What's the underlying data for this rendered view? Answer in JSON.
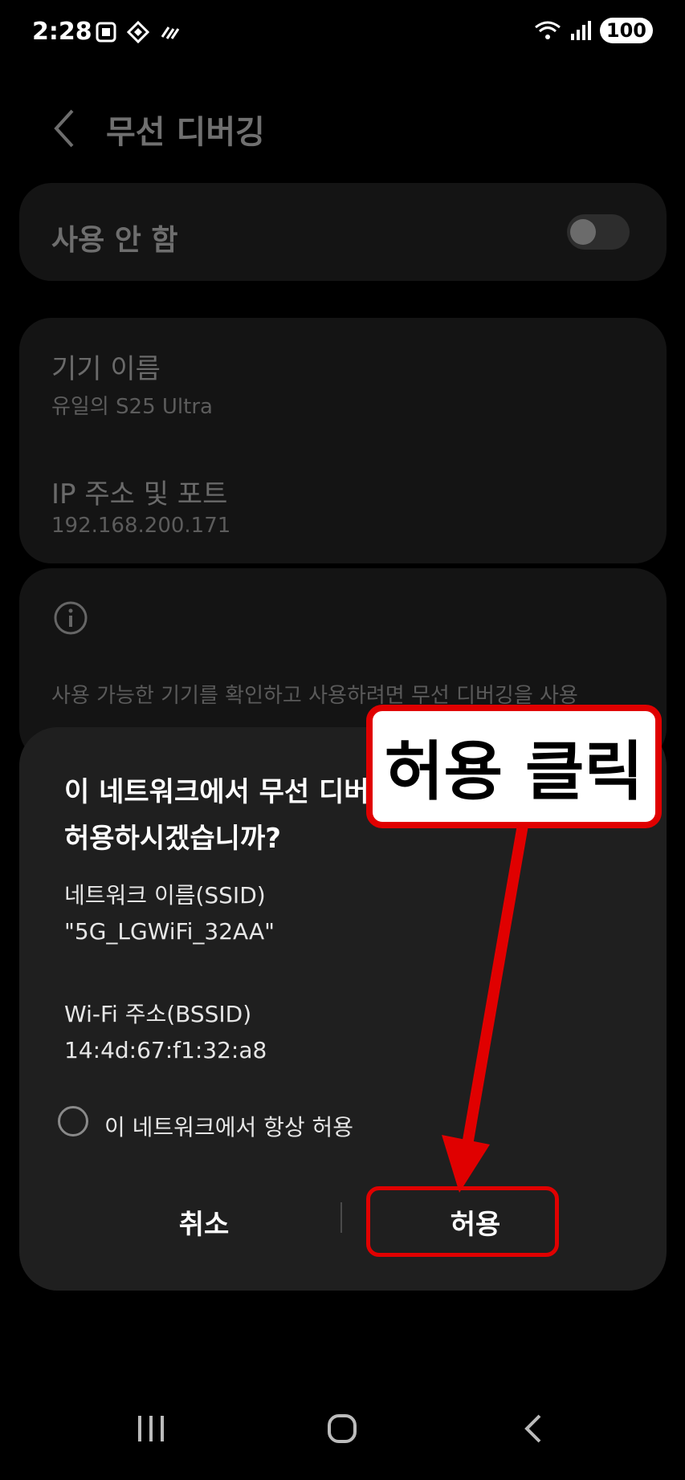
{
  "status_bar": {
    "time": "2:28",
    "battery": "100"
  },
  "header": {
    "title": "무선 디버깅"
  },
  "toggle_card": {
    "label": "사용 안 함"
  },
  "info_card": {
    "device_name_title": "기기 이름",
    "device_name_value": "유일의 S25 Ultra",
    "ip_title": "IP 주소 및 포트",
    "ip_value": "192.168.200.171"
  },
  "note_card": {
    "text": "사용 가능한 기기를 확인하고 사용하려면 무선 디버깅을 사용"
  },
  "dialog": {
    "title_line1": "이 네트워크에서 무선 디버",
    "title_line2": "허용하시겠습니까?",
    "ssid_label": "네트워크 이름(SSID)",
    "ssid_value": "\"5G_LGWiFi_32AA\"",
    "bssid_label": "Wi-Fi 주소(BSSID)",
    "bssid_value": "14:4d:67:f1:32:a8",
    "always_allow_label": "이 네트워크에서 항상 허용",
    "cancel_label": "취소",
    "allow_label": "허용"
  },
  "annotation": {
    "callout_text": "허용 클릭",
    "color": "#e00000"
  },
  "colors": {
    "background": "#000000",
    "dialog": "#1f1f1f",
    "card": "#141414"
  },
  "icons": [
    "screenshot-icon",
    "vpn-icon",
    "wifi-icon",
    "signal-icon",
    "info-icon",
    "back-icon",
    "recents-icon",
    "home-icon",
    "back-nav-icon"
  ]
}
